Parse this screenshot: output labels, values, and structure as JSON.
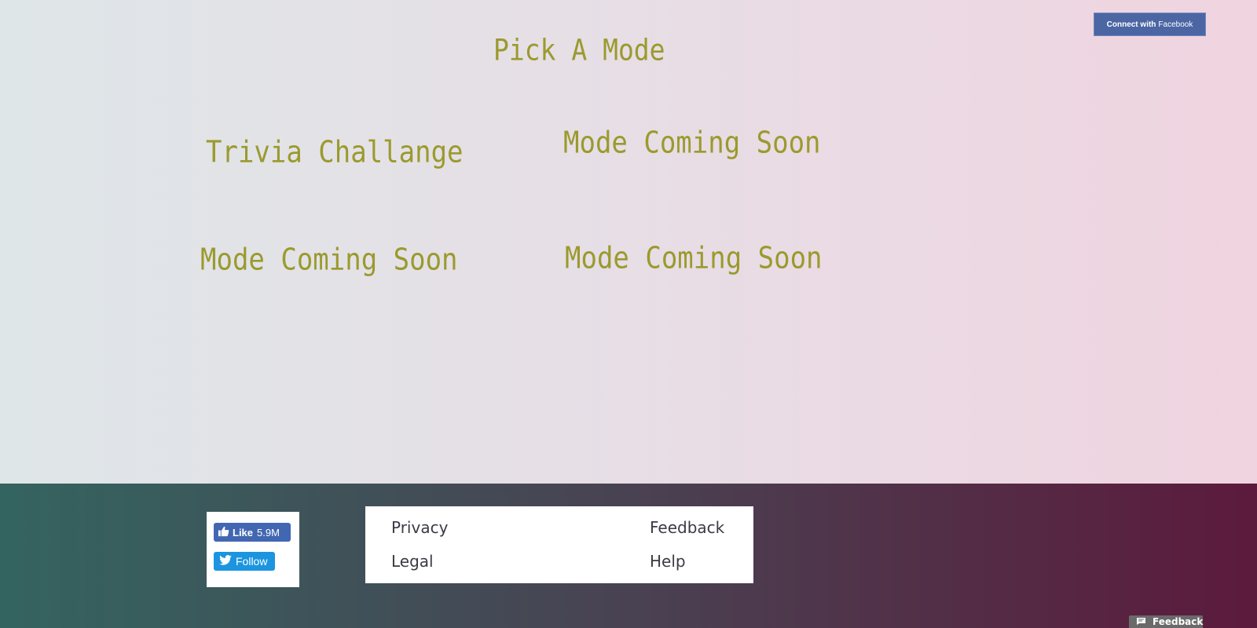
{
  "header": {
    "connect_bold": "Connect with",
    "connect_normal": "Facebook"
  },
  "page_title": "Pick A Mode",
  "modes": [
    {
      "label": "Trivia Challange"
    },
    {
      "label": "Mode Coming Soon"
    },
    {
      "label": "Mode Coming Soon"
    },
    {
      "label": "Mode Coming Soon"
    }
  ],
  "social": {
    "like_label": "Like",
    "like_count": "5.9M",
    "follow_label": "Follow"
  },
  "footer_links": {
    "privacy": "Privacy",
    "feedback": "Feedback",
    "legal": "Legal",
    "help": "Help"
  },
  "feedback_tab": {
    "label": "Feedback"
  },
  "colors": {
    "mode_text": "#9b9a2e",
    "facebook_blue": "#4267b2",
    "twitter_blue": "#1b95e0"
  }
}
